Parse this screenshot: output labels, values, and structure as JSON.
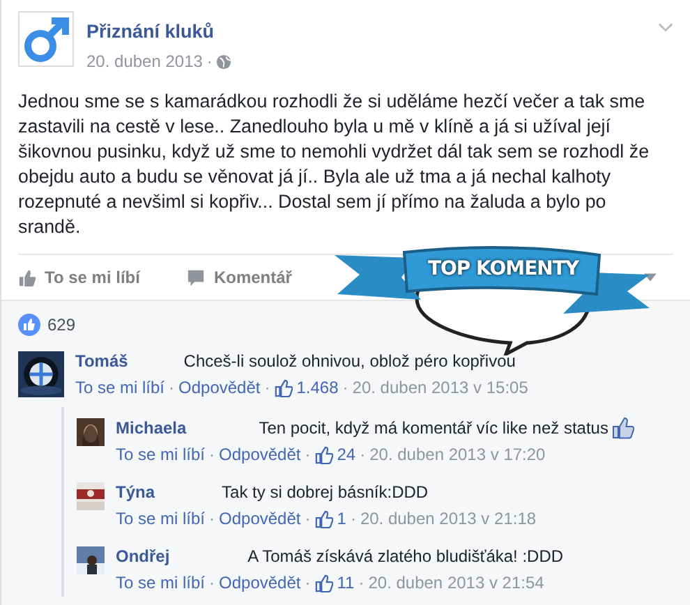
{
  "page": {
    "name": "Přiznání kluků",
    "date": "20. duben 2013",
    "separator": "·"
  },
  "post": {
    "text": "Jednou sme se s kamarádkou rozhodli že si uděláme hezčí večer a tak sme zastavili na cestě v lese.. Zanedlouho byla u mě v klíně a já si užíval její šikovnou pusinku, když už sme to nemohli vydržet dál tak sem se rozhodl že obejdu auto a budu se věnovat já jí.. Byla ale už tma a já nechal kalhoty rozepnuté a nevšiml si kopřiv... Dostal sem jí přímo na žaluda a bylo po srandě."
  },
  "actions": [
    {
      "label": "To se mi líbí",
      "kind": "like"
    },
    {
      "label": "Komentář",
      "kind": "comment"
    }
  ],
  "badge": {
    "text": "TOP KOMENTY"
  },
  "likes": {
    "count": "629"
  },
  "comments": [
    {
      "author": "Tomáš",
      "text": "Chceš-li soulož ohnivou, oblož péro kopřivou",
      "separator": "·",
      "like_label": "To se mi líbí",
      "reply_label": "Odpovědět",
      "likes": "1.468",
      "time": "20. duben 2013 v 15:05",
      "children": [
        {
          "author": "Michaela",
          "text": "Ten pocit, když má komentář víc like než status",
          "trailing_like_icon": true,
          "separator": "·",
          "like_label": "To se mi líbí",
          "reply_label": "Odpovědět",
          "likes": "24",
          "time": "20. duben 2013 v 17:20"
        },
        {
          "author": "Týna",
          "text": "Tak ty si dobrej básník:DDD",
          "separator": "·",
          "like_label": "To se mi líbí",
          "reply_label": "Odpovědět",
          "likes": "1",
          "time": "20. duben 2013 v 21:18"
        },
        {
          "author": "Ondřej",
          "text": "A Tomáš získává zlatého bludišťáka! :DDD",
          "separator": "·",
          "like_label": "To se mi líbí",
          "reply_label": "Odpovědět",
          "likes": "11",
          "time": "20. duben 2013 v 21:54"
        }
      ]
    }
  ]
}
